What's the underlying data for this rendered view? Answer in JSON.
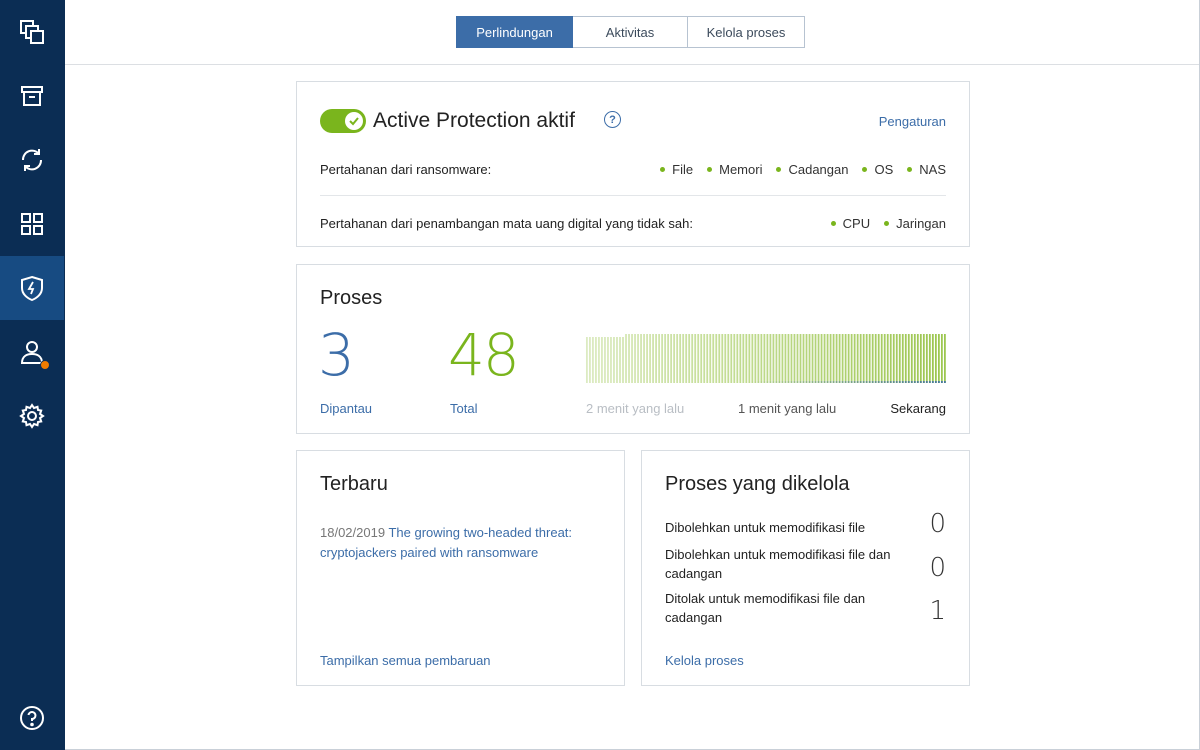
{
  "colors": {
    "sidebar": "#0b2d54",
    "sidebar_active": "#174b82",
    "accent_blue": "#3c6da8",
    "accent_green": "#7ab51d",
    "badge_orange": "#f07c00"
  },
  "sidebar": {
    "items": [
      {
        "icon": "backup-icon"
      },
      {
        "icon": "archive-icon"
      },
      {
        "icon": "sync-icon"
      },
      {
        "icon": "dashboard-grid-icon"
      },
      {
        "icon": "shield-icon",
        "active": true
      },
      {
        "icon": "account-icon",
        "badge": true
      },
      {
        "icon": "gear-icon"
      }
    ],
    "help_icon": "help-icon"
  },
  "tabs": [
    {
      "label": "Perlindungan",
      "active": true
    },
    {
      "label": "Aktivitas"
    },
    {
      "label": "Kelola proses"
    }
  ],
  "protection": {
    "title": "Active Protection aktif",
    "help": "?",
    "enabled": true,
    "settings_link": "Pengaturan",
    "ransomware_label": "Pertahanan dari ransomware:",
    "ransomware_items": [
      "File",
      "Memori",
      "Cadangan",
      "OS",
      "NAS"
    ],
    "mining_label": "Pertahanan dari penambangan mata uang digital yang tidak sah:",
    "mining_items": [
      "CPU",
      "Jaringan"
    ]
  },
  "processes": {
    "title": "Proses",
    "monitored_value": "3",
    "monitored_label": "Dipantau",
    "total_value": "48",
    "total_label": "Total",
    "time_labels": [
      "2 menit yang lalu",
      "1 menit yang lalu",
      "Sekarang"
    ]
  },
  "latest": {
    "title": "Terbaru",
    "date": "18/02/2019",
    "headline": "The growing two-headed threat: cryptojackers paired with ransomware",
    "link": "Tampilkan semua pembaruan"
  },
  "managed": {
    "title": "Proses yang dikelola",
    "rows": [
      {
        "label": "Dibolehkan untuk memodifikasi file",
        "value": "0"
      },
      {
        "label": "Dibolehkan untuk memodifikasi file dan cadangan",
        "value": "0"
      },
      {
        "label": "Ditolak untuk memodifikasi file dan cadangan",
        "value": "1"
      }
    ],
    "link": "Kelola proses"
  }
}
